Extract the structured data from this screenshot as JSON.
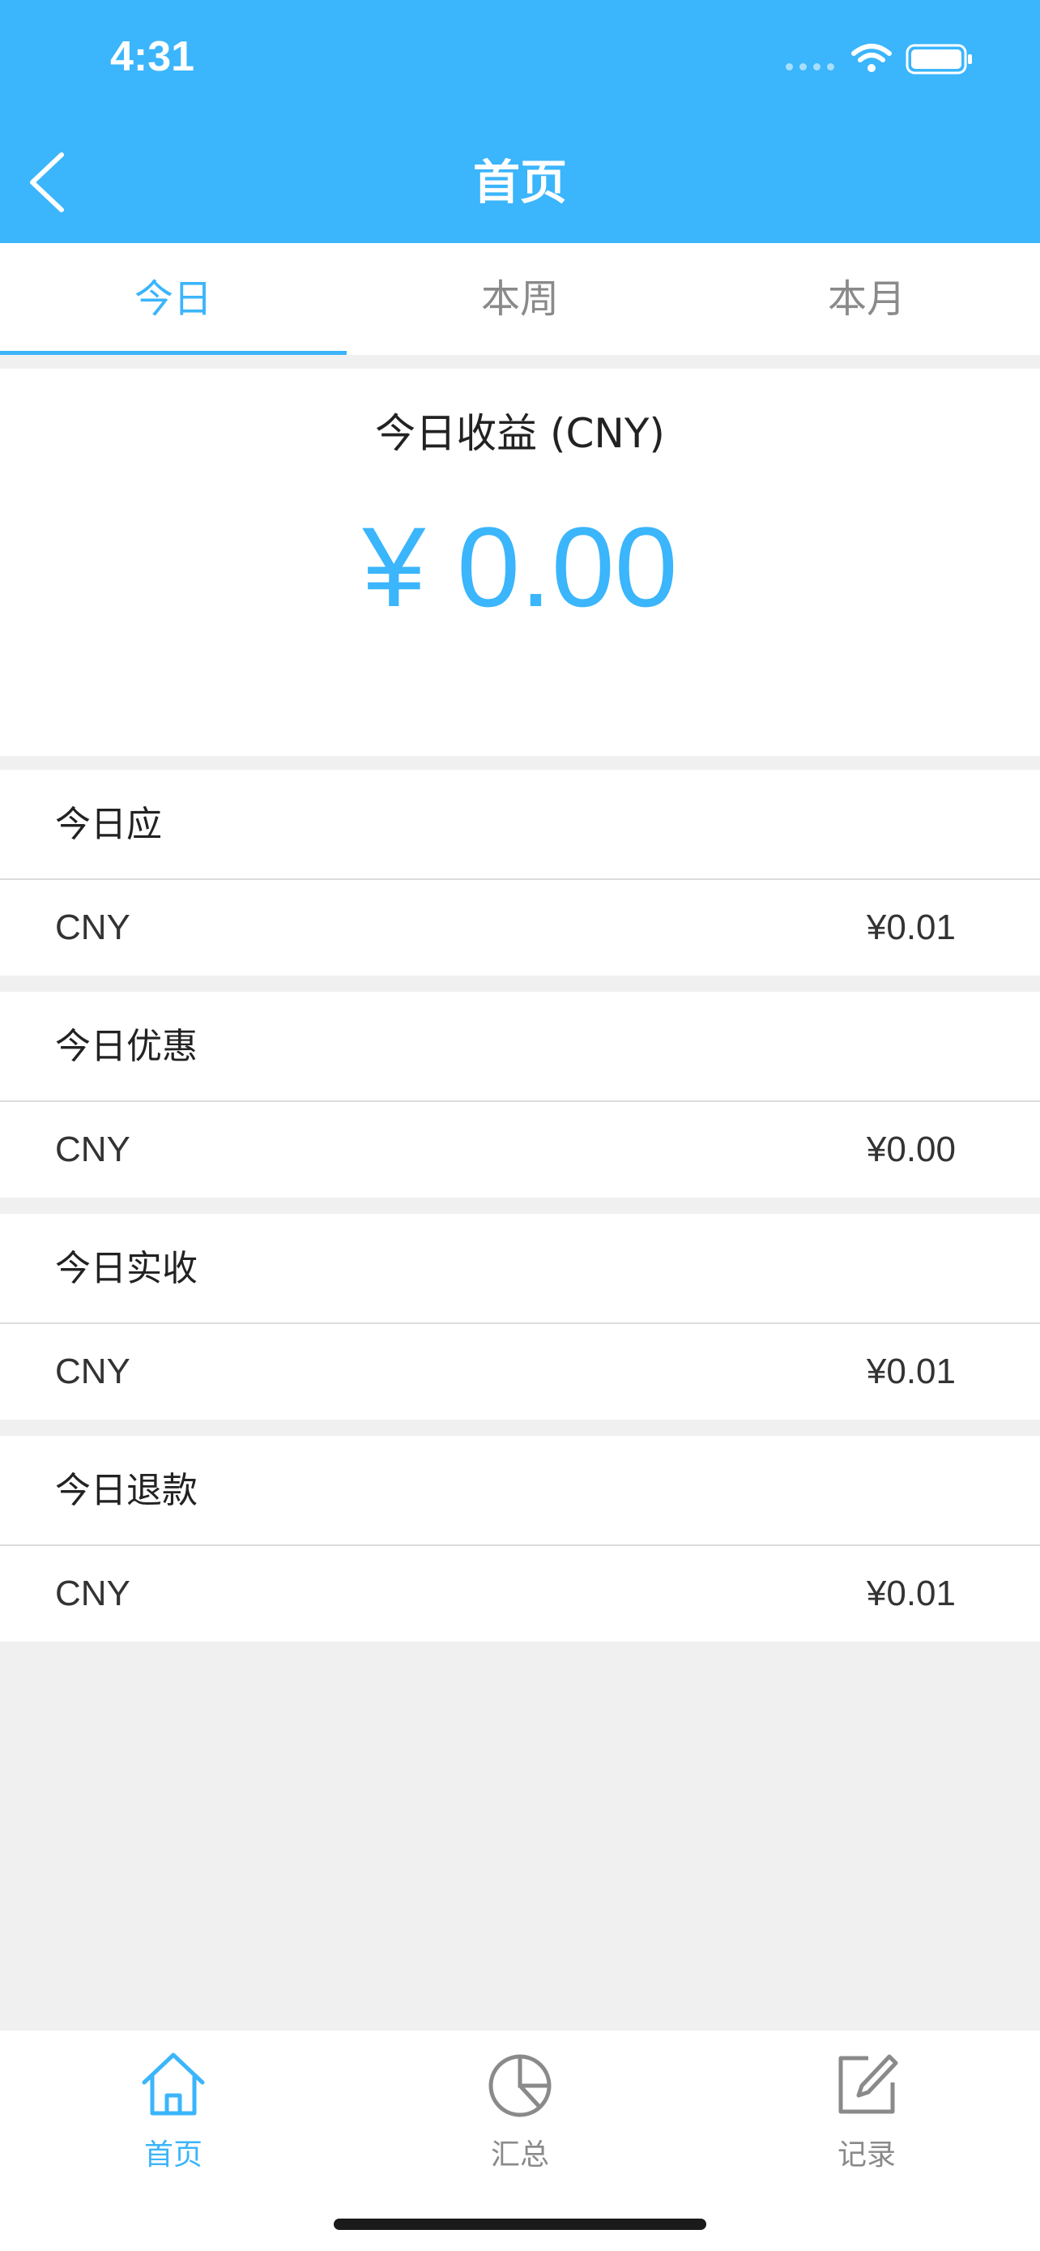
{
  "status_bar": {
    "time": "4:31"
  },
  "header": {
    "title": "首页",
    "back_icon": "chevron-left-icon"
  },
  "tabs": [
    {
      "label": "今日",
      "active": true
    },
    {
      "label": "本周",
      "active": false
    },
    {
      "label": "本月",
      "active": false
    }
  ],
  "summary": {
    "label": "今日收益 (CNY)",
    "amount": "¥ 0.00"
  },
  "sections": [
    {
      "title": "今日应",
      "currency": "CNY",
      "value": "¥0.01"
    },
    {
      "title": "今日优惠",
      "currency": "CNY",
      "value": "¥0.00"
    },
    {
      "title": "今日实收",
      "currency": "CNY",
      "value": "¥0.01"
    },
    {
      "title": "今日退款",
      "currency": "CNY",
      "value": "¥0.01"
    }
  ],
  "bottom_nav": [
    {
      "label": "首页",
      "icon": "home-icon",
      "active": true
    },
    {
      "label": "汇总",
      "icon": "pie-chart-icon",
      "active": false
    },
    {
      "label": "记录",
      "icon": "edit-icon",
      "active": false
    }
  ],
  "colors": {
    "accent": "#3bb5fb",
    "background": "#f0f0f0",
    "text": "#222222",
    "muted": "#8a8a8a"
  }
}
